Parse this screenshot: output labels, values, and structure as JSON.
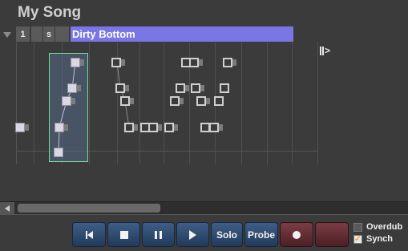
{
  "song": {
    "title": "My Song"
  },
  "track": {
    "number": "1",
    "solo_short": "s",
    "name": "Dirty Bottom",
    "name_color": "#7b76e6"
  },
  "end_marker": {
    "label": ">"
  },
  "transport": {
    "prev": {
      "icon": "skip-back-icon"
    },
    "stop": {
      "icon": "stop-icon"
    },
    "pause": {
      "icon": "pause-icon"
    },
    "play": {
      "icon": "play-icon"
    },
    "solo_label": "Solo",
    "probe_label": "Probe",
    "record": {
      "icon": "record-icon"
    }
  },
  "options": {
    "overdub": {
      "label": "Overdub",
      "checked": false
    },
    "synch": {
      "label": "Synch",
      "checked": true
    }
  },
  "colors": {
    "accent": "#7b76e6",
    "transport": "#2f4b70",
    "record": "#6a2f37",
    "selection_border": "#6fe0a0",
    "check_mark": "#ff9a1a"
  }
}
